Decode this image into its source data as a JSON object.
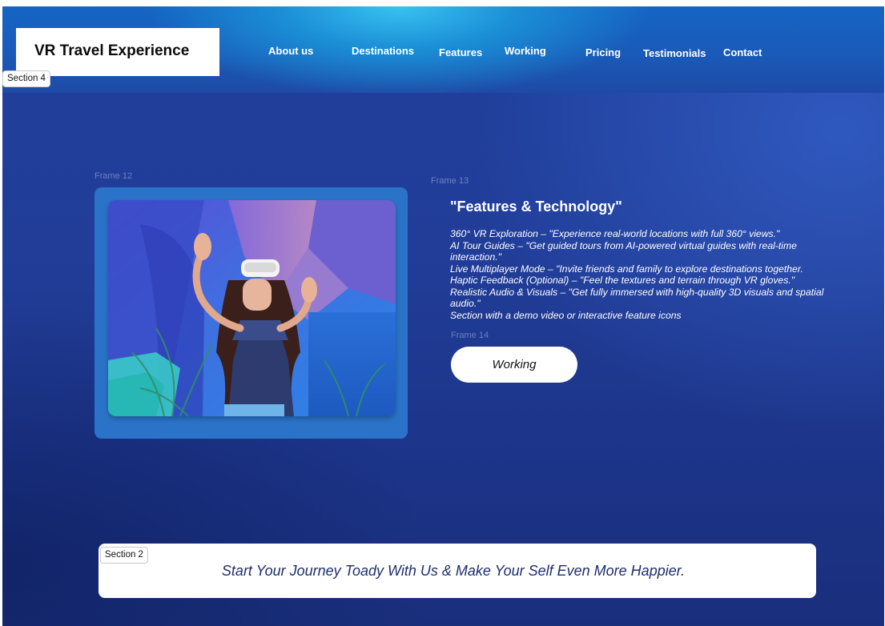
{
  "header": {
    "logo": "VR Travel Experience",
    "nav": [
      "About us",
      "Destinations",
      "Features",
      "Working",
      "Pricing",
      "Testimonials",
      "Contact"
    ]
  },
  "labels": {
    "section4": "Section 4",
    "section2": "Section 2",
    "frame12": "Frame 12",
    "frame13": "Frame 13",
    "frame14": "Frame 14"
  },
  "features": {
    "title": "\"Features & Technology\"",
    "lines": [
      "360° VR Exploration – \"Experience real-world locations with full 360° views.\"",
      "AI Tour Guides – \"Get guided tours from AI-powered virtual guides with real-time interaction.\"",
      "Live Multiplayer Mode – \"Invite friends and family to explore destinations together.",
      "Haptic Feedback (Optional) – \"Feel the textures and terrain through VR gloves.\"",
      "Realistic Audio & Visuals – \"Get fully immersed with high-quality 3D visuals and spatial audio.\"",
      "Section with a demo video or interactive feature icons"
    ],
    "button": "Working"
  },
  "cta": {
    "text": "Start Your Journey Toady With Us & Make Your Self Even More Happier."
  },
  "colors": {
    "background": "#1f3f9c",
    "header_highlight": "#39c2f2",
    "card": "#2a73c8",
    "cta_text": "#1d2e6b"
  }
}
